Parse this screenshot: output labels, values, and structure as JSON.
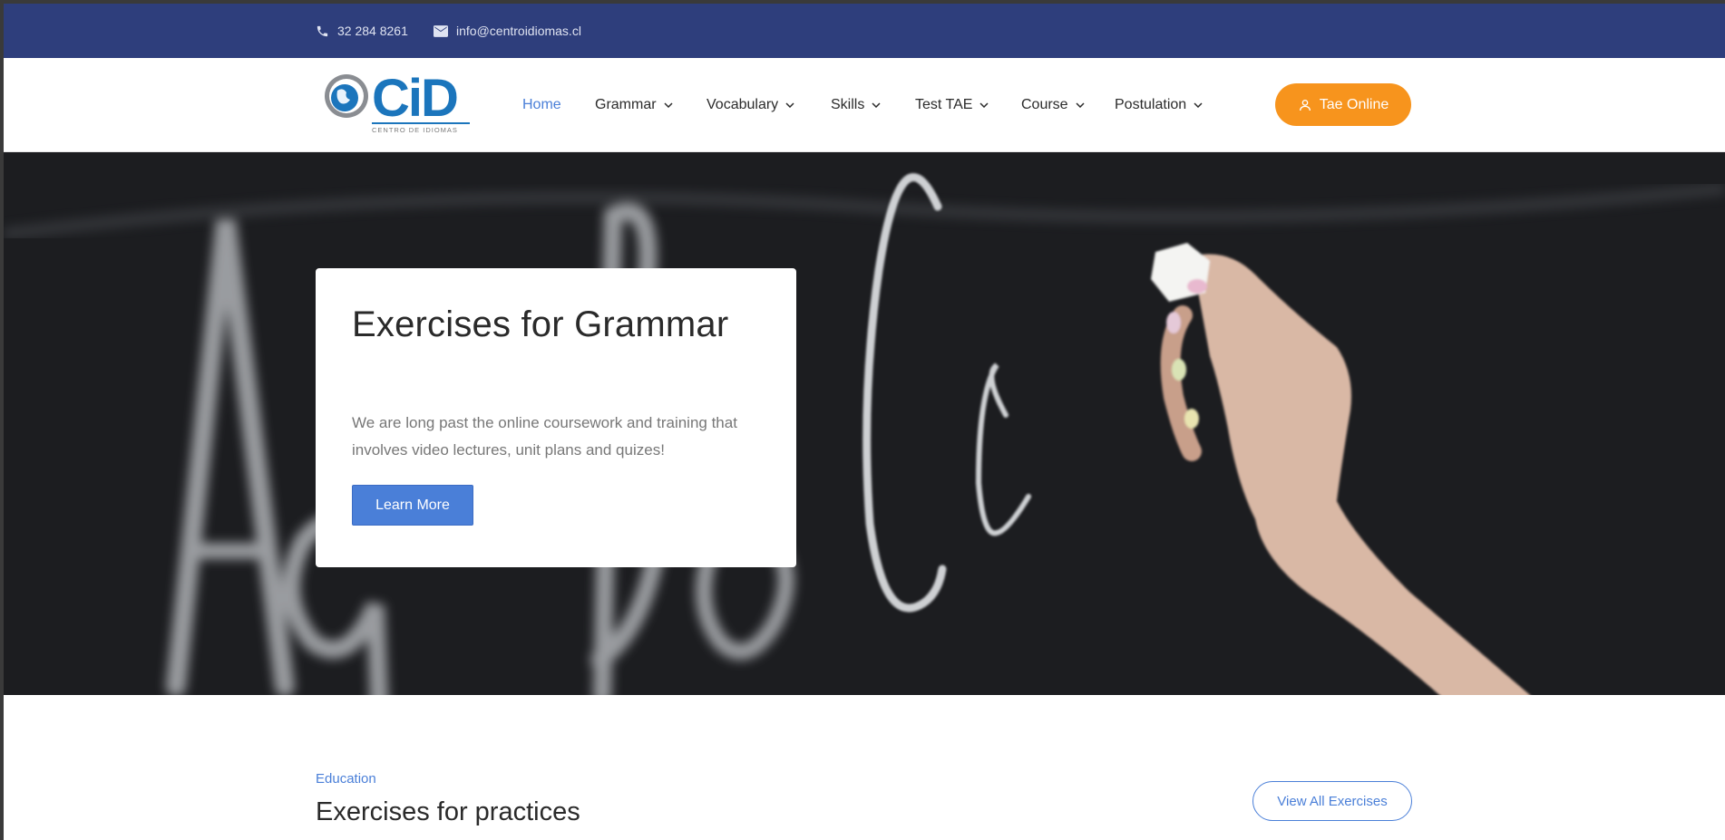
{
  "topbar": {
    "phone": "32 284 8261",
    "email": "info@centroidiomas.cl"
  },
  "logo": {
    "text": "CiD",
    "subtitle": "CENTRO DE IDIOMAS"
  },
  "nav": {
    "items": [
      {
        "label": "Home",
        "active": true
      },
      {
        "label": "Grammar"
      },
      {
        "label": "Vocabulary"
      },
      {
        "label": "Skills"
      },
      {
        "label": "Test TAE"
      },
      {
        "label": "Course"
      },
      {
        "label": "Postulation"
      }
    ],
    "cta_label": "Tae Online"
  },
  "hero": {
    "title": "Exercises for Grammar",
    "text": "We are long past the online coursework and training that involves video lectures, unit plans and quizes!",
    "button": "Learn More"
  },
  "section": {
    "eyebrow": "Education",
    "title": "Exercises for practices",
    "button": "View All Exercises"
  },
  "colors": {
    "topbar": "#2e3e7c",
    "accent_blue": "#4a7fd8",
    "accent_orange": "#f7941d"
  }
}
